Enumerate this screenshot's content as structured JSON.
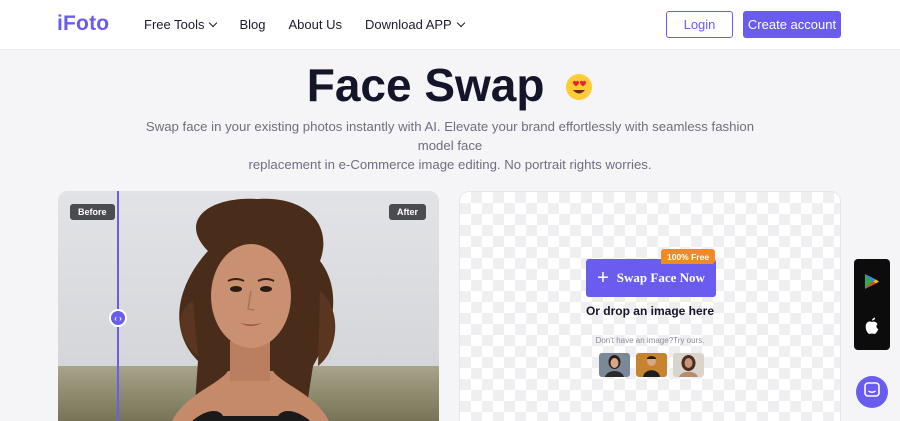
{
  "header": {
    "logo": "iFoto",
    "nav": [
      {
        "label": "Free Tools",
        "has_dropdown": true
      },
      {
        "label": "Blog",
        "has_dropdown": false
      },
      {
        "label": "About Us",
        "has_dropdown": false
      },
      {
        "label": "Download APP",
        "has_dropdown": true
      }
    ],
    "login_label": "Login",
    "create_account_label": "Create account"
  },
  "hero": {
    "title": "Face Swap",
    "title_emoji": "😍",
    "subtitle_line1": "Swap face in your existing photos instantly with AI. Elevate your brand effortlessly with seamless fashion model face",
    "subtitle_line2": "replacement in e-Commerce image editing. No portrait rights worries."
  },
  "compare": {
    "before_label": "Before",
    "after_label": "After",
    "slider_position": 0.16,
    "handle_glyph": "‹ ›"
  },
  "upload": {
    "free_tag": "100% Free",
    "button_label": "Swap Face Now",
    "button_icon": "plus-icon",
    "drop_text": "Or drop an image here",
    "try_text": "Don't have an image?Try ours."
  },
  "side_apps": {
    "icons": [
      "google-play-icon",
      "apple-icon"
    ]
  },
  "colors": {
    "accent": "#6b5cf0",
    "free_tag": "#f08a24",
    "app_bar": "#0c0c0c"
  }
}
